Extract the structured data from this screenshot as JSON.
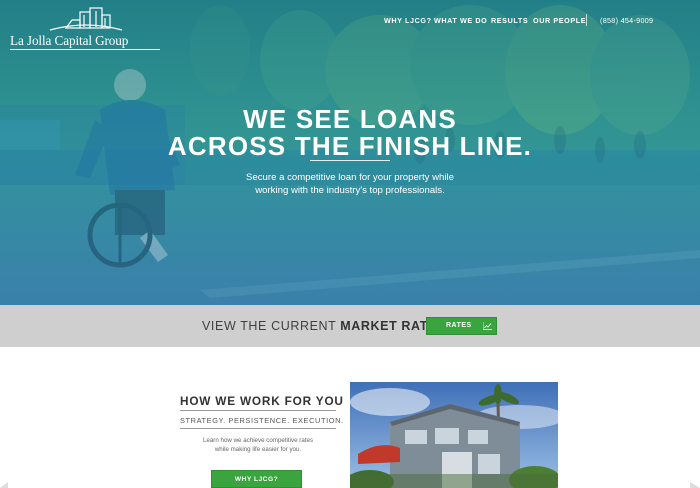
{
  "brand": {
    "logo_text": "La Jolla Capital Group"
  },
  "nav": {
    "items": [
      {
        "label": "WHY LJCG?"
      },
      {
        "label": "WHAT WE DO"
      },
      {
        "label": "RESULTS"
      },
      {
        "label": "OUR PEOPLE"
      }
    ],
    "phone": "(858) 454-9009"
  },
  "hero": {
    "headline_line1": "WE SEE LOANS",
    "headline_line2": "ACROSS THE FINISH LINE.",
    "subtext": "Secure a competitive loan for your property while working with the industry's top professionals."
  },
  "rates_bar": {
    "text_prefix": "VIEW THE CURRENT",
    "text_bold": "MARKET RATES",
    "button_label": "RATES",
    "button_icon": "line-chart-icon",
    "background": "#cfcfcf",
    "button_color": "#3aa53f"
  },
  "how": {
    "title": "HOW WE WORK FOR YOU",
    "tagline": "STRATEGY.  PERSISTENCE.  EXECUTION.",
    "description": "Learn how we achieve competitive rates while making life easier for you.",
    "button_label": "WHY LJCG?"
  },
  "colors": {
    "accent_green": "#3aa53f",
    "hero_teal": "#2a8f9a",
    "text_dark": "#333333"
  }
}
